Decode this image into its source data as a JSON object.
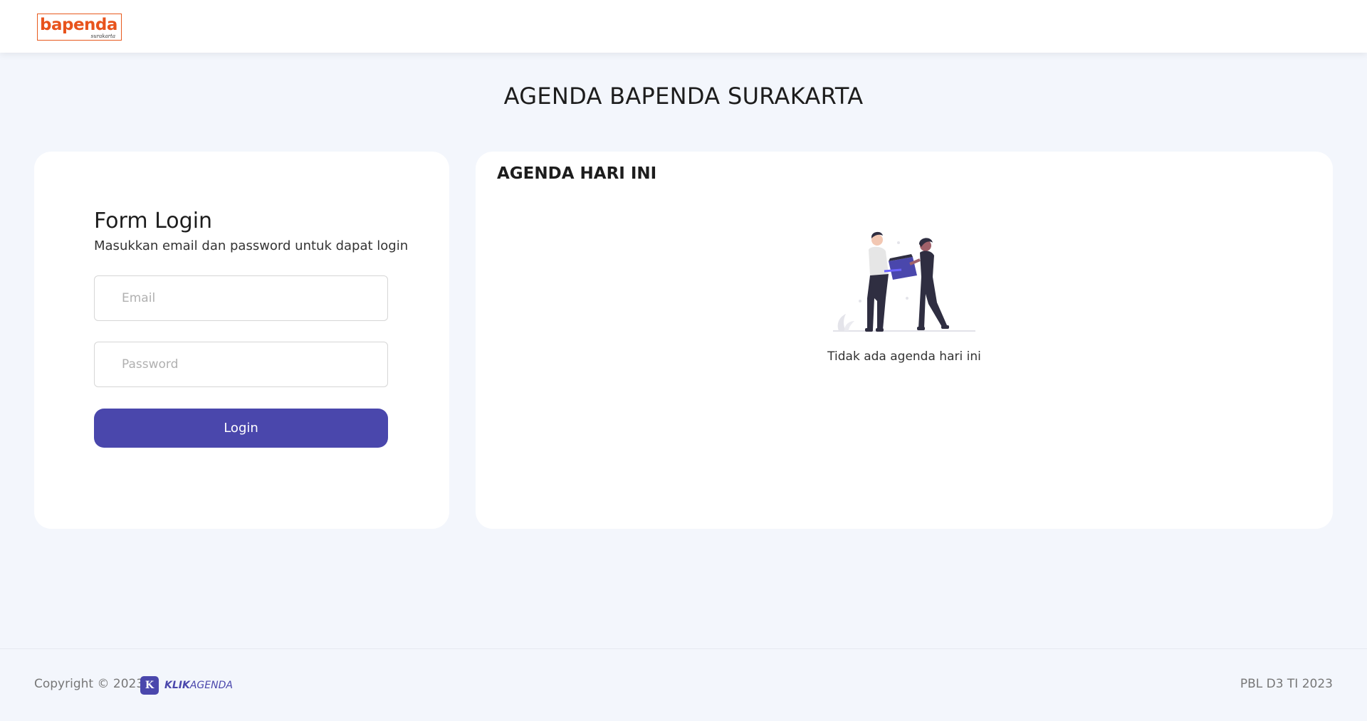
{
  "navbar": {
    "logo_text": "bapenda",
    "logo_subtext": "surakarta"
  },
  "page": {
    "title": "AGENDA BAPENDA SURAKARTA"
  },
  "login": {
    "title": "Form Login",
    "subtitle": "Masukkan email dan password untuk dapat login",
    "email_placeholder": "Email",
    "email_value": "",
    "password_placeholder": "Password",
    "password_value": "",
    "button_label": "Login"
  },
  "agenda": {
    "title": "AGENDA HARI INI",
    "illustration_icon": "people-handing-box-illustration",
    "empty_message": "Tidak ada agenda hari ini"
  },
  "footer": {
    "copyright": "Copyright © 2023",
    "brand_badge": "K",
    "brand_bold": "KLIK",
    "brand_rest": "AGENDA",
    "credit": "PBL D3 TI 2023"
  },
  "colors": {
    "primary": "#4a47ac",
    "background": "#f3f6fc",
    "logo_orange": "#e8531c"
  }
}
